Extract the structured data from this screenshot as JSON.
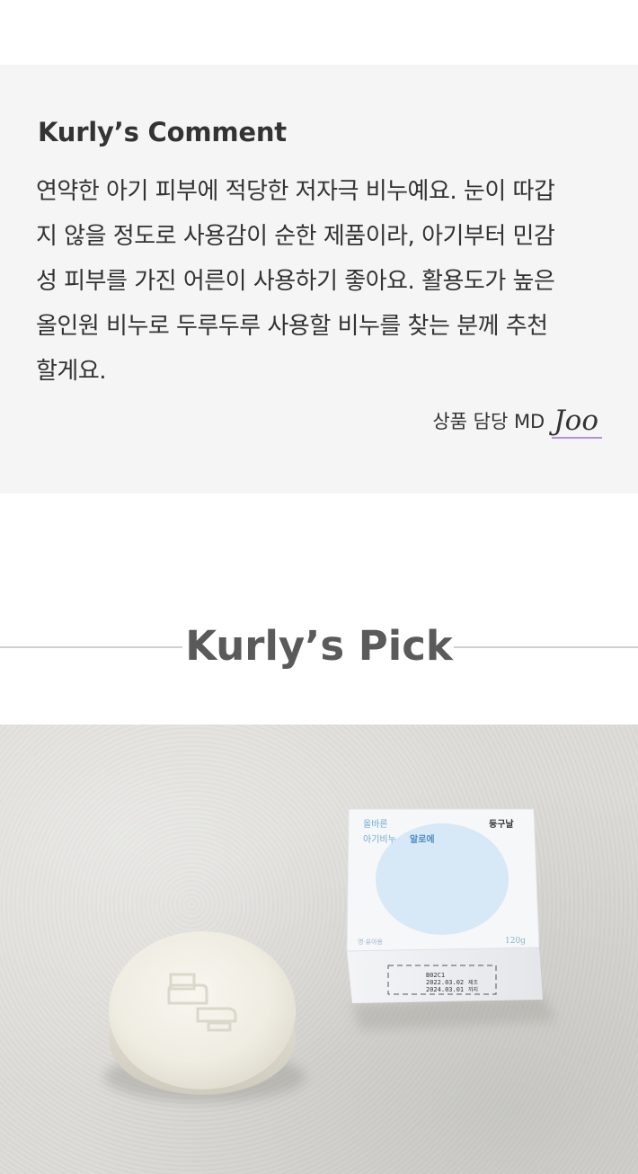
{
  "comment": {
    "title": "Kurly’s Comment",
    "lines": [
      "연약한 아기 피부에 적당한 저자극 비누예요. 눈이 따갑",
      "지 않을 정도로 사용감이 순한 제품이라, 아기부터 민감",
      "성 피부를 가진 어른이 사용하기 좋아요. 활용도가 높은",
      "올인원 비누로 두루두루 사용할 비누를 찾는 분께 추천",
      "할게요."
    ],
    "md_label": "상품 담당 MD",
    "md_signature": "Joo"
  },
  "pick": {
    "title": "Kurly’s Pick"
  },
  "product_box": {
    "line1": "올바른",
    "line2_a": "아기비누",
    "line2_b": "알로에",
    "brand": "둥구날",
    "tag": "영·유아용",
    "weight": "120g",
    "lot": "B02C1",
    "mfg_date": "2022.03.02",
    "mfg_suffix": "제조",
    "exp_date": "2024.03.01",
    "exp_suffix": "까지",
    "colors": {
      "circle": "#d7e8f6",
      "accent_text": "#6fa9d6",
      "brand_text": "#3a3a3a"
    }
  }
}
